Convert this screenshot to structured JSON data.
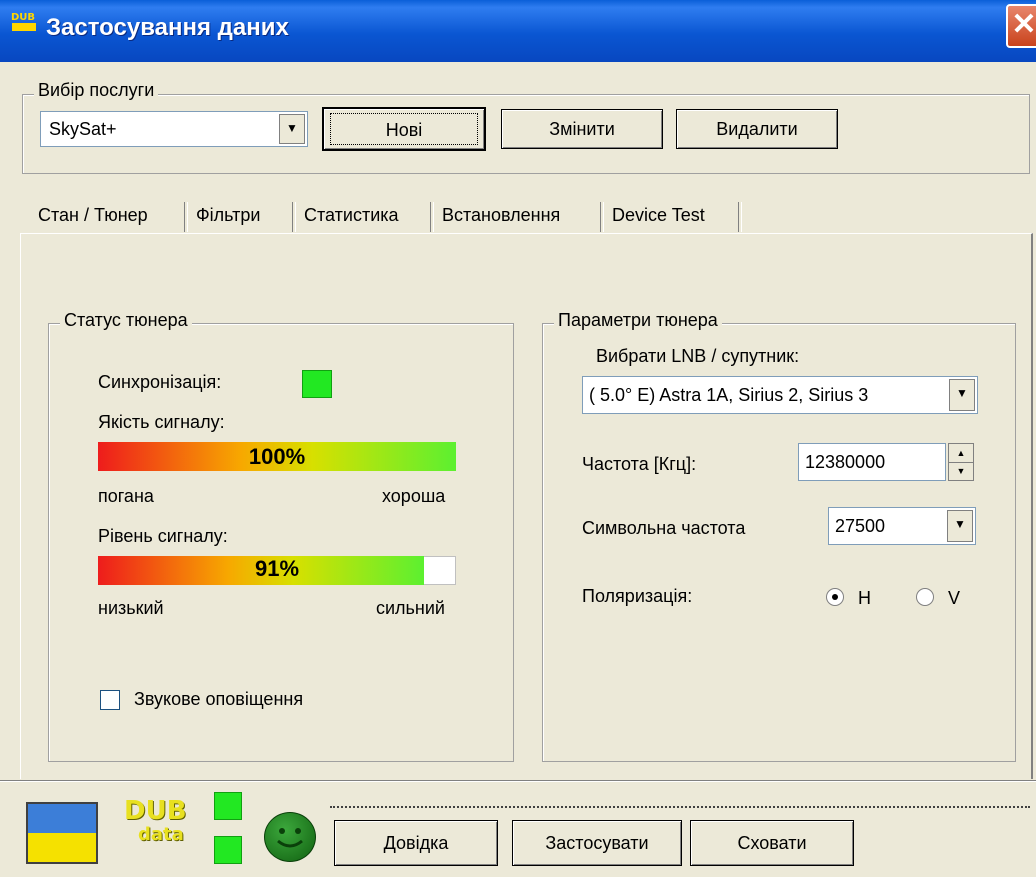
{
  "window": {
    "title": "Застосування даних",
    "icon_text": "DUB"
  },
  "service": {
    "legend": "Вибір послуги",
    "selected": "SkySat+",
    "buttons": {
      "new": "Нові",
      "edit": "Змінити",
      "delete": "Видалити"
    }
  },
  "tabs": [
    {
      "label": "Стан / Тюнер"
    },
    {
      "label": "Фільтри"
    },
    {
      "label": "Статистика"
    },
    {
      "label": "Встановлення"
    },
    {
      "label": "Device Test"
    }
  ],
  "status": {
    "legend": "Статус тюнера",
    "sync_label": "Синхронізація:",
    "quality_label": "Якість сигналу:",
    "quality_value": "100%",
    "quality_fraction": 1.0,
    "quality_low": "погана",
    "quality_high": "хороша",
    "level_label": "Рівень сигналу:",
    "level_value": "91%",
    "level_fraction": 0.91,
    "level_low": "низький",
    "level_high": "сильний",
    "sound_label": "Звукове оповіщення"
  },
  "params": {
    "legend": "Параметри тюнера",
    "lnb_label": "Вибрати LNB / супутник:",
    "lnb_value": "(   5.0° E) Astra 1A, Sirius 2, Sirius 3",
    "freq_label": "Частота [Кгц]:",
    "freq_value": "12380000",
    "symrate_label": "Символьна частота",
    "symrate_value": "27500",
    "pol_label": "Поляризація:",
    "pol_h": "H",
    "pol_v": "V",
    "pol_selected": "H"
  },
  "footer": {
    "logo_text_top": "DUB",
    "logo_text_bottom": "data",
    "help": "Довідка",
    "apply": "Застосувати",
    "hide": "Сховати"
  },
  "colors": {
    "titlebar": "#0a56d2",
    "led": "#22e822",
    "face": "#ece9d8"
  }
}
